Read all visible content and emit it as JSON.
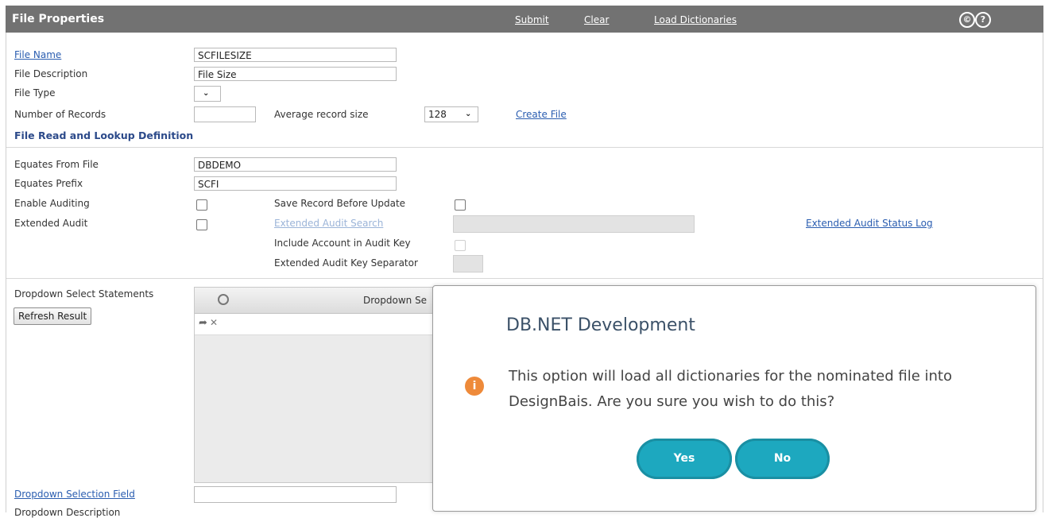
{
  "header": {
    "title": "File Properties",
    "links": {
      "submit": "Submit",
      "clear": "Clear",
      "load_dictionaries": "Load Dictionaries"
    },
    "icons": [
      "copyright-icon",
      "help-icon"
    ]
  },
  "form": {
    "file_name": {
      "label": "File Name",
      "value": "SCFILESIZE"
    },
    "file_description": {
      "label": "File Description",
      "value": "File Size"
    },
    "file_type": {
      "label": "File Type",
      "value": ""
    },
    "number_of_records": {
      "label": "Number of Records",
      "value": ""
    },
    "average_record_size": {
      "label": "Average record size",
      "value": "128"
    },
    "create_file": "Create File",
    "section_title": "File Read and Lookup Definition",
    "equates_from_file": {
      "label": "Equates From File",
      "value": "DBDEMO"
    },
    "equates_prefix": {
      "label": "Equates Prefix",
      "value": "SCFI"
    },
    "enable_auditing": {
      "label": "Enable Auditing",
      "checked": false
    },
    "save_record_before_update": {
      "label": "Save Record Before Update",
      "checked": false
    },
    "extended_audit": {
      "label": "Extended Audit",
      "checked": false
    },
    "extended_audit_search": {
      "label": "Extended Audit Search",
      "value": ""
    },
    "extended_audit_status_log": "Extended Audit Status Log",
    "include_account_in_audit_key": {
      "label": "Include Account in Audit Key",
      "checked": false
    },
    "extended_audit_key_separator": {
      "label": "Extended Audit Key Separator",
      "value": ""
    },
    "dropdown_select_statements": {
      "label": "Dropdown Select Statements"
    },
    "refresh_result": "Refresh Result",
    "grid": {
      "column_header": "Dropdown Se"
    },
    "dropdown_selection_field": {
      "label": "Dropdown Selection Field",
      "value": ""
    },
    "dropdown_description": {
      "label": "Dropdown Description"
    }
  },
  "dialog": {
    "title": "DB.NET Development",
    "message": "This option will load all dictionaries for the nominated file into DesignBais. Are you sure you wish to do this?",
    "yes_label": "Yes",
    "no_label": "No",
    "icon": "info-icon",
    "accent_color": "#1da8bf",
    "info_color": "#ee8a3a"
  },
  "colors": {
    "header_bg": "#727272",
    "link": "#2a5db0",
    "section": "#2c4a8a"
  }
}
